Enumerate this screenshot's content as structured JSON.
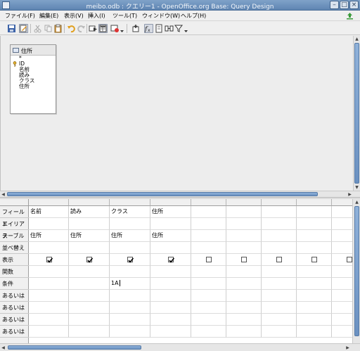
{
  "window": {
    "title": "meibo.odb : クエリー1 - OpenOffice.org Base: Query Design"
  },
  "menu": {
    "items": [
      "ファイル(F)",
      "編集(E)",
      "表示(V)",
      "挿入(I)",
      "ツール(T)",
      "ウィンドウ(W)",
      "ヘルプ(H)"
    ]
  },
  "toolbar": {
    "icons": [
      "save-icon",
      "edit-icon",
      "cut-icon",
      "copy-icon",
      "paste-icon",
      "undo-icon",
      "redo-icon",
      "run-query-icon",
      "clear-query-icon",
      "design-view-icon",
      "add-tables-icon",
      "functions-icon",
      "table-name-icon",
      "alias-icon",
      "distinct-values-icon"
    ]
  },
  "table_window": {
    "title": "住所",
    "fields": [
      "*",
      "ID",
      "名前",
      "読み",
      "クラス",
      "住所"
    ],
    "primary_key_field": "ID"
  },
  "grid": {
    "row_headers": [
      "フィールド",
      "エイリアス",
      "テーブル",
      "並べ替え",
      "表示",
      "関数",
      "条件",
      "あるいは",
      "あるいは",
      "あるいは",
      "あるいは"
    ],
    "columns": [
      {
        "field": "名前",
        "alias": "",
        "table": "住所",
        "sort": "",
        "visible": true,
        "function": "",
        "criterion": ""
      },
      {
        "field": "読み",
        "alias": "",
        "table": "住所",
        "sort": "",
        "visible": true,
        "function": "",
        "criterion": ""
      },
      {
        "field": "クラス",
        "alias": "",
        "table": "住所",
        "sort": "",
        "visible": true,
        "function": "",
        "criterion": "1A"
      },
      {
        "field": "住所",
        "alias": "",
        "table": "住所",
        "sort": "",
        "visible": true,
        "function": "",
        "criterion": ""
      },
      {
        "field": "",
        "alias": "",
        "table": "",
        "sort": "",
        "visible": false,
        "function": "",
        "criterion": ""
      },
      {
        "field": "",
        "alias": "",
        "table": "",
        "sort": "",
        "visible": false,
        "function": "",
        "criterion": ""
      },
      {
        "field": "",
        "alias": "",
        "table": "",
        "sort": "",
        "visible": false,
        "function": "",
        "criterion": ""
      },
      {
        "field": "",
        "alias": "",
        "table": "",
        "sort": "",
        "visible": false,
        "function": "",
        "criterion": ""
      },
      {
        "field": "",
        "alias": "",
        "table": "",
        "sort": "",
        "visible": false,
        "function": "",
        "criterion": ""
      }
    ]
  },
  "colors": {
    "titlebar": "#6a8fbb",
    "scroll_thumb": "#7a9fcd"
  }
}
